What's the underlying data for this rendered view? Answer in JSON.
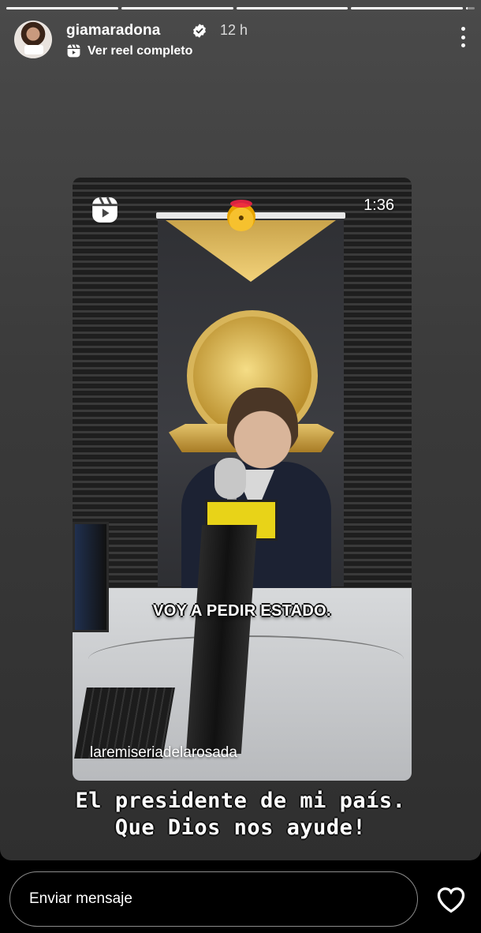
{
  "story": {
    "progress": [
      1,
      1,
      1,
      1,
      0.15
    ],
    "header": {
      "username": "giamaradona",
      "time": "12 h",
      "reel_link": "Ver reel completo"
    },
    "reel": {
      "duration": "1:36",
      "subtitle": "VOY A PEDIR ESTADO.",
      "author": "laremiseriadelarosada"
    },
    "caption": {
      "line1": "El presidente de mi país.",
      "line2": "Que Dios nos ayude!"
    }
  },
  "bottom_bar": {
    "message_placeholder": "Enviar mensaje"
  },
  "icons": {
    "verified": "verified-badge-icon",
    "reels": "reels-icon",
    "more": "more-options-icon",
    "heart": "heart-icon",
    "sticker": "exploding-head-emoji"
  },
  "colors": {
    "background": "#000000",
    "text": "#ffffff"
  }
}
